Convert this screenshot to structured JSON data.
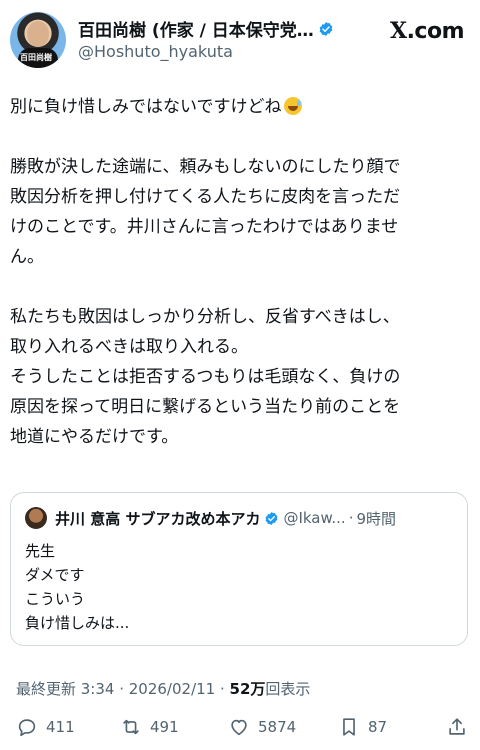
{
  "header": {
    "display_name": "百田尚樹 (作家 / 日本保守党…",
    "handle": "@Hoshuto_hyakuta",
    "site_x": "X",
    "site_suffix": ".com",
    "avatar_sign": "百田尚樹"
  },
  "tweet": {
    "para1": [
      "別に負け惜しみではないですけどね"
    ],
    "para2": [
      "勝敗が決した途端に、頼みもしないのにしたり顔で",
      "敗因分析を押し付けてくる人たちに皮肉を言っただ",
      "けのことです。井川さんに言ったわけではありませ",
      "ん。"
    ],
    "para3": [
      "私たちも敗因はしっかり分析し、反省すべきはし、",
      "取り入れるべきは取り入れる。",
      "そうしたことは拒否するつもりは毛頭なく、負けの",
      "原因を探って明日に繋げるという当たり前のことを",
      "地道にやるだけです。"
    ]
  },
  "quote": {
    "name": "井川 意高 サブアカ改め本アカ",
    "handle": "@Ikaw...",
    "dot": "·",
    "time": "9時間",
    "lines": [
      "先生",
      "ダメです",
      "こういう",
      "負け惜しみは..."
    ]
  },
  "meta": {
    "updated": "最終更新 3:34 · 2026/02/11 · ",
    "views_num": "52万",
    "views_label": "回表示"
  },
  "actions": {
    "replies": "411",
    "reposts": "491",
    "likes": "5874",
    "bookmarks": "87"
  },
  "colors": {
    "verified": "#1d9bf0",
    "muted": "#536471",
    "text": "#0f1419"
  },
  "icons": [
    "verified-badge-icon",
    "reply-icon",
    "repost-icon",
    "like-icon",
    "bookmark-icon",
    "share-icon"
  ]
}
